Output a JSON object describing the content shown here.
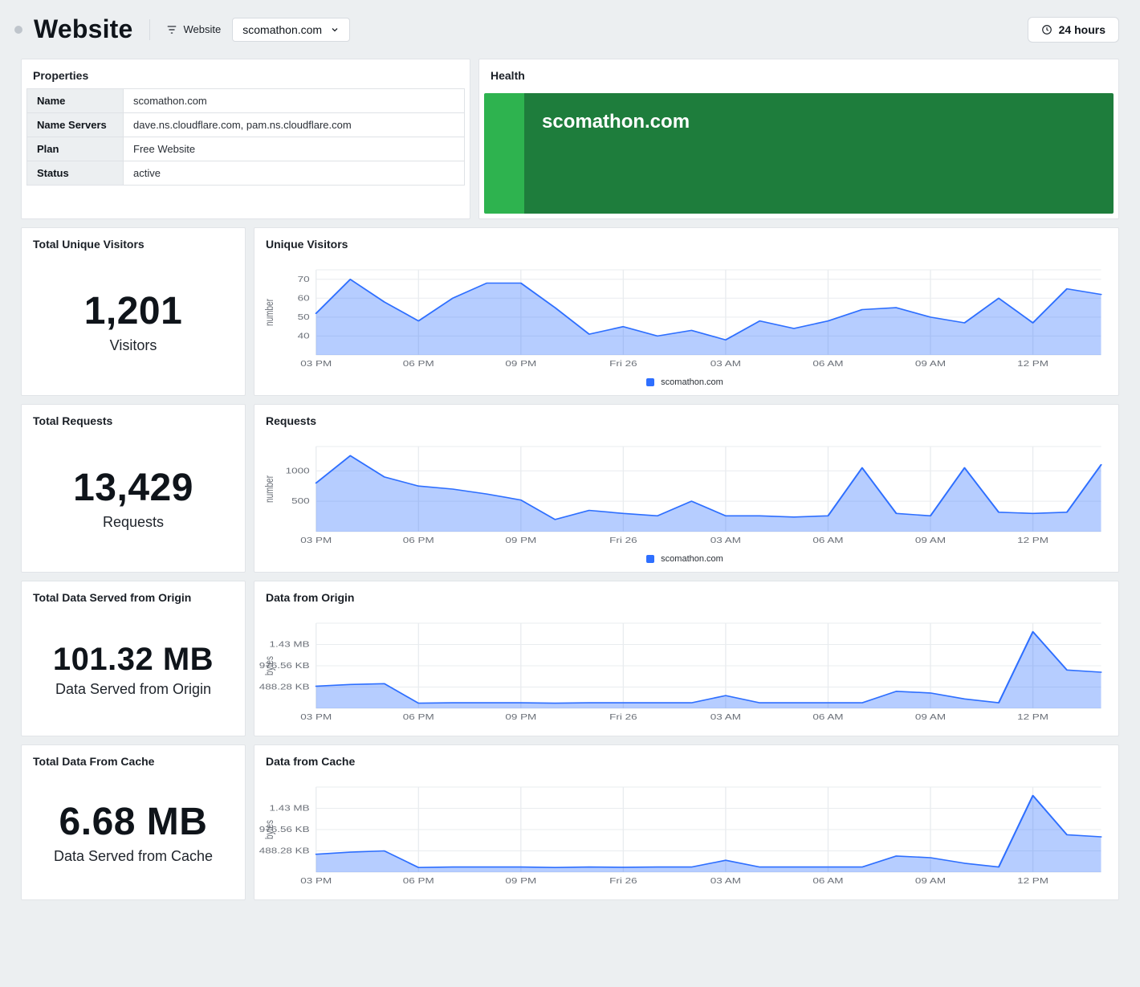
{
  "header": {
    "title": "Website",
    "scope_label": "Website",
    "site_selected": "scomathon.com",
    "time_range": "24 hours"
  },
  "properties": {
    "title": "Properties",
    "rows": [
      {
        "key": "Name",
        "value": "scomathon.com"
      },
      {
        "key": "Name Servers",
        "value": "dave.ns.cloudflare.com, pam.ns.cloudflare.com"
      },
      {
        "key": "Plan",
        "value": "Free Website"
      },
      {
        "key": "Status",
        "value": "active"
      }
    ]
  },
  "health": {
    "title": "Health",
    "site": "scomathon.com",
    "status_color_left": "#2eb34f",
    "status_color_right": "#1e7d3c"
  },
  "metrics": [
    {
      "id": "visitors",
      "stat_title": "Total Unique Visitors",
      "stat_value": "1,201",
      "stat_label": "Visitors",
      "chart_title": "Unique Visitors",
      "legend": "scomathon.com"
    },
    {
      "id": "requests",
      "stat_title": "Total Requests",
      "stat_value": "13,429",
      "stat_label": "Requests",
      "chart_title": "Requests",
      "legend": "scomathon.com"
    },
    {
      "id": "data_origin",
      "stat_title": "Total Data Served from Origin",
      "stat_value": "101.32 MB",
      "stat_label": "Data Served from Origin",
      "chart_title": "Data from Origin",
      "legend": "scomathon.com"
    },
    {
      "id": "data_cache",
      "stat_title": "Total Data From Cache",
      "stat_value": "6.68 MB",
      "stat_label": "Data Served from Cache",
      "chart_title": "Data from Cache",
      "legend": "scomathon.com"
    }
  ],
  "chart_data": [
    {
      "id": "visitors",
      "type": "area",
      "title": "Unique Visitors",
      "ylabel": "number",
      "ylim": [
        30,
        75
      ],
      "yticks": [
        40,
        50,
        60,
        70
      ],
      "x": [
        "03 PM",
        "04 PM",
        "05 PM",
        "06 PM",
        "07 PM",
        "08 PM",
        "09 PM",
        "10 PM",
        "11 PM",
        "Fri 26",
        "01 AM",
        "02 AM",
        "03 AM",
        "04 AM",
        "05 AM",
        "06 AM",
        "07 AM",
        "08 AM",
        "09 AM",
        "10 AM",
        "11 AM",
        "12 PM",
        "01 PM",
        "02 PM"
      ],
      "xticks": [
        "03 PM",
        "06 PM",
        "09 PM",
        "Fri 26",
        "03 AM",
        "06 AM",
        "09 AM",
        "12 PM"
      ],
      "series": [
        {
          "name": "scomathon.com",
          "values": [
            52,
            70,
            58,
            48,
            60,
            68,
            68,
            55,
            41,
            45,
            40,
            43,
            38,
            48,
            44,
            48,
            54,
            55,
            50,
            47,
            60,
            47,
            65,
            62
          ]
        }
      ]
    },
    {
      "id": "requests",
      "type": "area",
      "title": "Requests",
      "ylabel": "number",
      "ylim": [
        0,
        1400
      ],
      "yticks": [
        500,
        1000
      ],
      "x": [
        "03 PM",
        "04 PM",
        "05 PM",
        "06 PM",
        "07 PM",
        "08 PM",
        "09 PM",
        "10 PM",
        "11 PM",
        "Fri 26",
        "01 AM",
        "02 AM",
        "03 AM",
        "04 AM",
        "05 AM",
        "06 AM",
        "07 AM",
        "08 AM",
        "09 AM",
        "10 AM",
        "11 AM",
        "12 PM",
        "01 PM",
        "02 PM"
      ],
      "xticks": [
        "03 PM",
        "06 PM",
        "09 PM",
        "Fri 26",
        "03 AM",
        "06 AM",
        "09 AM",
        "12 PM"
      ],
      "series": [
        {
          "name": "scomathon.com",
          "values": [
            800,
            1250,
            900,
            750,
            700,
            620,
            520,
            200,
            350,
            300,
            260,
            500,
            260,
            260,
            240,
            260,
            1050,
            300,
            260,
            1050,
            320,
            300,
            320,
            1100
          ]
        }
      ]
    },
    {
      "id": "data_origin",
      "type": "area",
      "title": "Data from Origin",
      "ylabel": "bytes",
      "ylim": [
        0,
        2000000
      ],
      "yticks_labels": [
        "488.28 KB",
        "976.56 KB",
        "1.43 MB"
      ],
      "yticks": [
        500000,
        1000000,
        1500000
      ],
      "x": [
        "03 PM",
        "04 PM",
        "05 PM",
        "06 PM",
        "07 PM",
        "08 PM",
        "09 PM",
        "10 PM",
        "11 PM",
        "Fri 26",
        "01 AM",
        "02 AM",
        "03 AM",
        "04 AM",
        "05 AM",
        "06 AM",
        "07 AM",
        "08 AM",
        "09 AM",
        "10 AM",
        "11 AM",
        "12 PM",
        "01 PM",
        "02 PM"
      ],
      "xticks": [
        "03 PM",
        "06 PM",
        "09 PM",
        "Fri 26",
        "03 AM",
        "06 AM",
        "09 AM",
        "12 PM"
      ],
      "series": [
        {
          "name": "scomathon.com",
          "values": [
            520000,
            560000,
            580000,
            120000,
            130000,
            130000,
            130000,
            120000,
            130000,
            130000,
            130000,
            130000,
            300000,
            130000,
            130000,
            130000,
            130000,
            400000,
            360000,
            220000,
            130000,
            1800000,
            900000,
            850000
          ]
        }
      ]
    },
    {
      "id": "data_cache",
      "type": "area",
      "title": "Data from Cache",
      "ylabel": "bytes",
      "ylim": [
        0,
        2000000
      ],
      "yticks_labels": [
        "488.28 KB",
        "976.56 KB",
        "1.43 MB"
      ],
      "yticks": [
        500000,
        1000000,
        1500000
      ],
      "x": [
        "03 PM",
        "04 PM",
        "05 PM",
        "06 PM",
        "07 PM",
        "08 PM",
        "09 PM",
        "10 PM",
        "11 PM",
        "Fri 26",
        "01 AM",
        "02 AM",
        "03 AM",
        "04 AM",
        "05 AM",
        "06 AM",
        "07 AM",
        "08 AM",
        "09 AM",
        "10 AM",
        "11 AM",
        "12 PM",
        "01 PM",
        "02 PM"
      ],
      "xticks": [
        "03 PM",
        "06 PM",
        "09 PM",
        "Fri 26",
        "03 AM",
        "06 AM",
        "09 AM",
        "12 PM"
      ],
      "series": [
        {
          "name": "scomathon.com",
          "values": [
            420000,
            470000,
            500000,
            110000,
            120000,
            120000,
            120000,
            110000,
            120000,
            115000,
            120000,
            120000,
            280000,
            120000,
            120000,
            120000,
            120000,
            380000,
            340000,
            210000,
            120000,
            1800000,
            880000,
            830000
          ]
        }
      ]
    }
  ]
}
